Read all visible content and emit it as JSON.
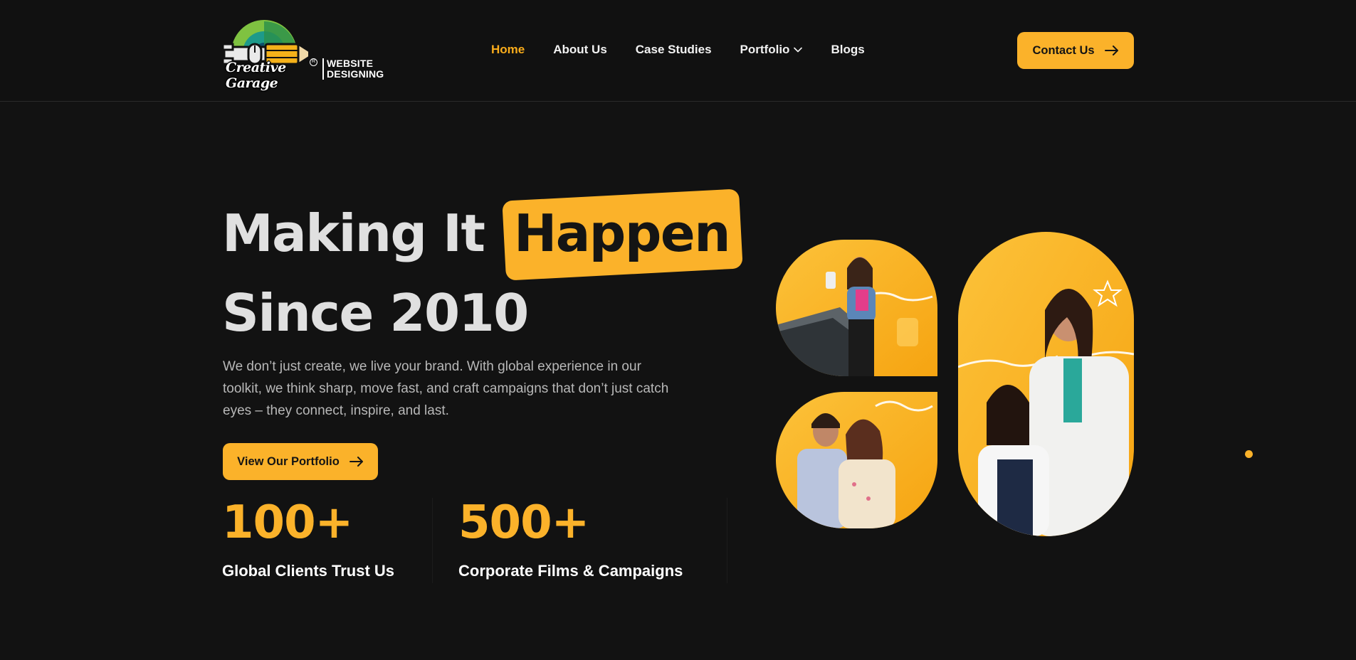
{
  "header": {
    "logo": {
      "brand": "Creative Garage",
      "tagline_line1": "WEBSITE",
      "tagline_line2": "DESIGNING",
      "reg": "R"
    },
    "nav": [
      {
        "label": "Home",
        "active": true
      },
      {
        "label": "About Us",
        "active": false
      },
      {
        "label": "Case Studies",
        "active": false
      },
      {
        "label": "Portfolio",
        "active": false,
        "dropdown": true
      },
      {
        "label": "Blogs",
        "active": false
      }
    ],
    "contact_label": "Contact Us"
  },
  "hero": {
    "title_part1": "Making It",
    "title_highlight": "Happen",
    "title_line2": "Since 2010",
    "description": "We don’t just create, we live your brand. With global experience in our toolkit, we think sharp, move fast, and craft campaigns that don’t just catch eyes – they connect, inspire, and last.",
    "portfolio_label": "View Our Portfolio"
  },
  "stats": [
    {
      "number": "100+",
      "label": "Global Clients Trust Us"
    },
    {
      "number": "500+",
      "label": "Corporate Films & Campaigns"
    }
  ],
  "colors": {
    "accent": "#fbb22a",
    "active_nav": "#f9ac1b",
    "background": "#121212",
    "header_bg": "#111111"
  },
  "icons": {
    "arrow": "arrow-right-icon",
    "chevron": "chevron-down-icon"
  }
}
